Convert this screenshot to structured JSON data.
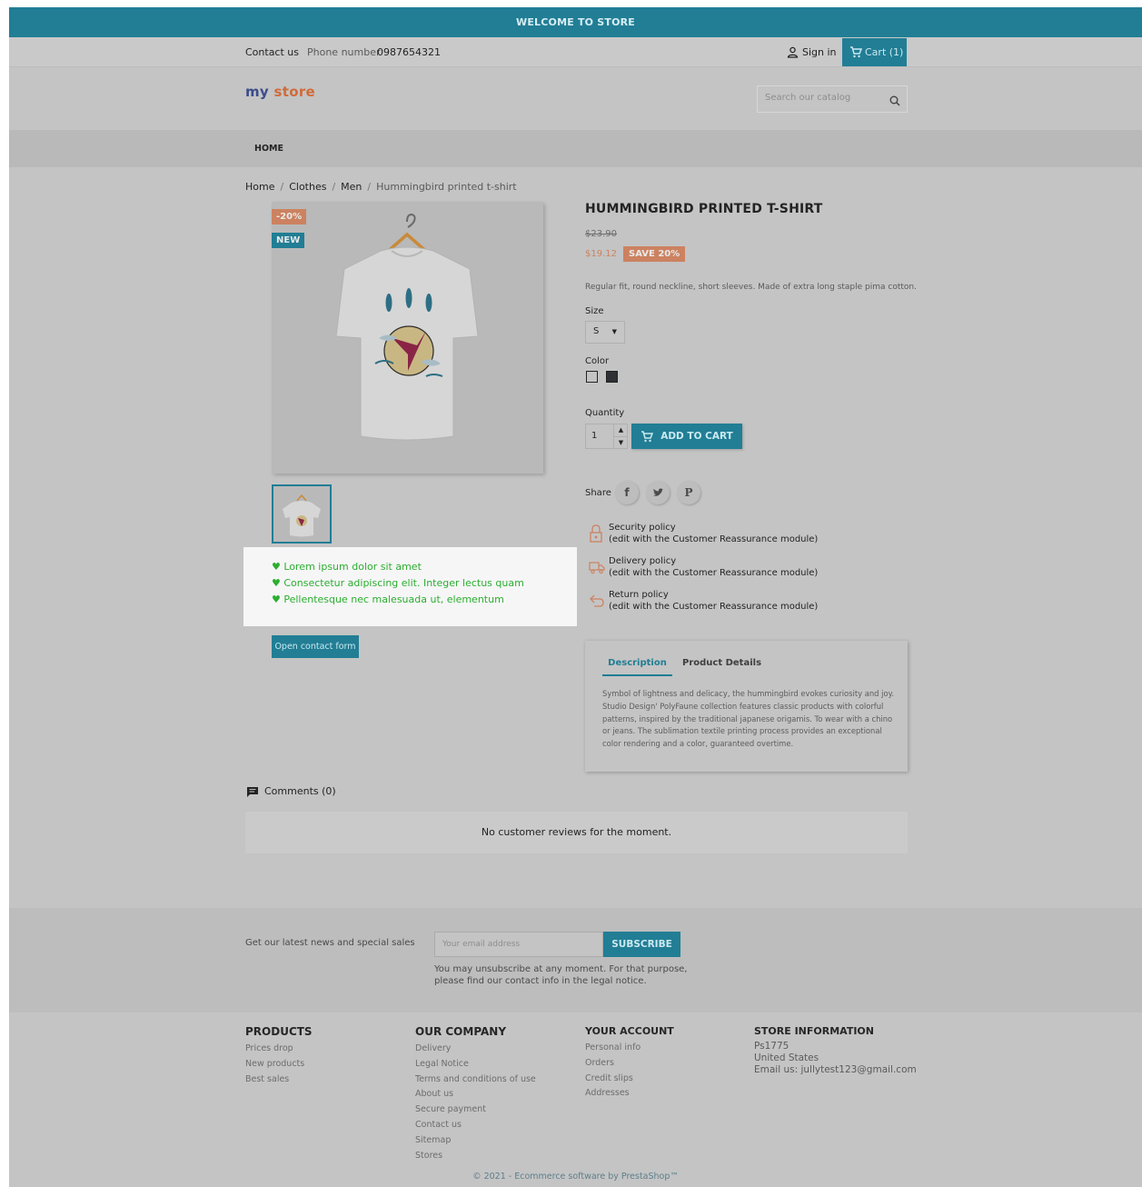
{
  "banner": "WELCOME TO STORE",
  "topnav": {
    "contact": "Contact us",
    "phone_label": "Phone number",
    "phone": "0987654321",
    "signin": "Sign in",
    "cart": "Cart (1)"
  },
  "logo": {
    "part1": "my",
    "part2": "store"
  },
  "search": {
    "placeholder": "Search our catalog"
  },
  "menu": {
    "home": "HOME"
  },
  "breadcrumb": {
    "home": "Home",
    "clothes": "Clothes",
    "men": "Men",
    "current": "Hummingbird printed t-shirt",
    "sep": "/"
  },
  "product": {
    "discount_flag": "-20%",
    "new_flag": "NEW",
    "title": "HUMMINGBIRD PRINTED T-SHIRT",
    "old_price": "$23.90",
    "price": "$19.12",
    "save": "SAVE 20%",
    "short_desc": "Regular fit, round neckline, short sleeves. Made of extra long staple pima cotton.",
    "size_label": "Size",
    "size_value": "S",
    "color_label": "Color",
    "quantity_label": "Quantity",
    "quantity": "1",
    "add_to_cart": "ADD TO CART",
    "share_label": "Share",
    "colors": [
      "#c4c4c4",
      "#2f2f36"
    ]
  },
  "features": [
    "Lorem ipsum dolor sit amet",
    "Consectetur adipiscing elit. Integer lectus quam",
    "Pellentesque nec malesuada ut, elementum"
  ],
  "contact_button": "Open contact form",
  "reassurance": [
    {
      "title": "Security policy",
      "sub": "(edit with the Customer Reassurance module)"
    },
    {
      "title": "Delivery policy",
      "sub": "(edit with the Customer Reassurance module)"
    },
    {
      "title": "Return policy",
      "sub": "(edit with the Customer Reassurance module)"
    }
  ],
  "tabs": {
    "description": "Description",
    "details": "Product Details"
  },
  "description_lines": [
    "Symbol of lightness and delicacy, the hummingbird evokes curiosity and joy.",
    "Studio Design' PolyFaune collection features classic products with colorful",
    "patterns, inspired by the traditional japanese origamis. To wear with a chino",
    "or jeans. The sublimation textile printing process provides an exceptional",
    "color rendering and a color, guaranteed overtime."
  ],
  "comments": {
    "label": "Comments (0)",
    "empty": "No customer reviews for the moment."
  },
  "newsletter": {
    "label": "Get our latest news and special sales",
    "placeholder": "Your email address",
    "subscribe": "SUBSCRIBE",
    "note1": "You may unsubscribe at any moment. For that purpose,",
    "note2": "please find our contact info in the legal notice."
  },
  "footer": {
    "products": {
      "title": "PRODUCTS",
      "links": [
        "Prices drop",
        "New products",
        "Best sales"
      ]
    },
    "company": {
      "title": "OUR COMPANY",
      "links": [
        "Delivery",
        "Legal Notice",
        "Terms and conditions of use",
        "About us",
        "Secure payment",
        "Contact us",
        "Sitemap",
        "Stores"
      ]
    },
    "account": {
      "title": "YOUR ACCOUNT",
      "links": [
        "Personal info",
        "Orders",
        "Credit slips",
        "Addresses"
      ]
    },
    "store": {
      "title": "STORE INFORMATION",
      "lines": [
        "Ps1775",
        "United States"
      ],
      "email_label": "Email us:",
      "email": "jullytest123@gmail.com"
    },
    "copyright": "© 2021 - Ecommerce software by PrestaShop™"
  },
  "accent": "#217e95"
}
